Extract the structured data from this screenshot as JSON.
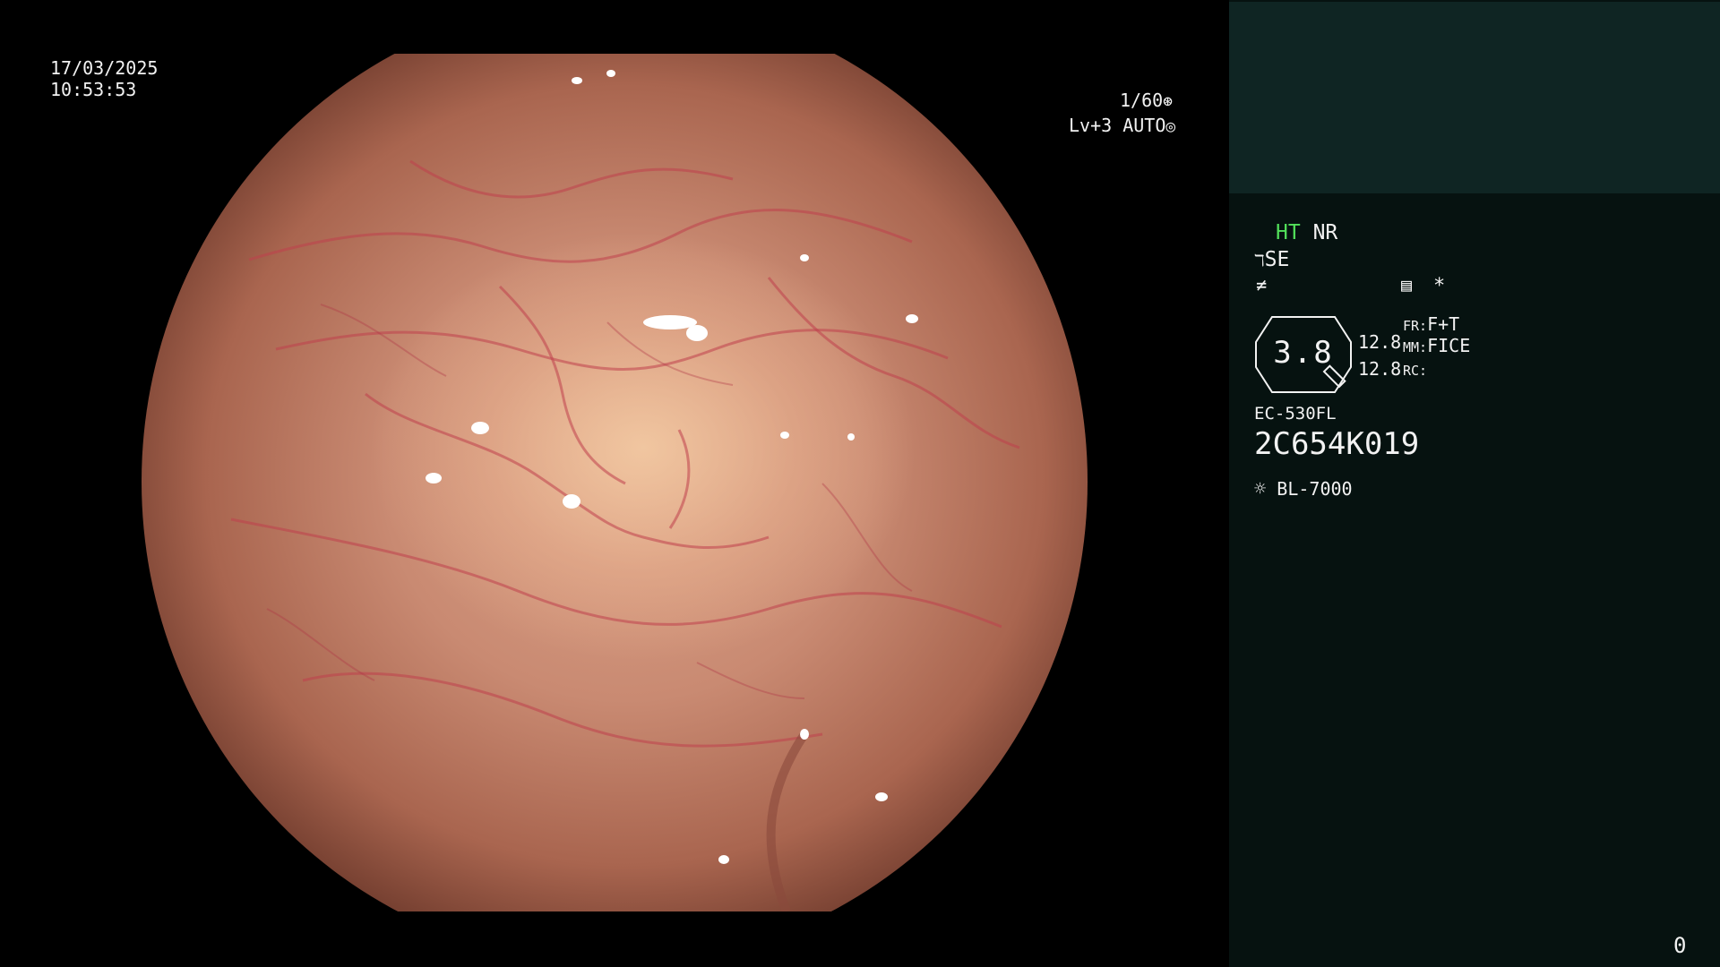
{
  "osd": {
    "date": "17/03/2025",
    "time": "10:53:53",
    "shutter": "1/60",
    "level": "Lv+3",
    "iris_mode": "AUTO"
  },
  "panel": {
    "ht_label": "HT",
    "nr_label": "NR",
    "se_label": "SE",
    "star": "*",
    "zoom_value": "3.8",
    "value_top": "12.8",
    "value_bottom": "12.8",
    "fr_label": "FR:",
    "fr_value": "F+T",
    "mm_label": "MM:",
    "mm_value": "FICE",
    "rc_label": "RC:",
    "scope_model": "EC-530FL",
    "scope_serial": "2C654K019",
    "light_source": "BL-7000",
    "counter": "0"
  },
  "colors": {
    "panel_bg": "#061210",
    "panel_top_bg": "#0f2523",
    "ht_green": "#52e05a",
    "mucosa": "#d9a086",
    "vessel": "#c0404c"
  }
}
